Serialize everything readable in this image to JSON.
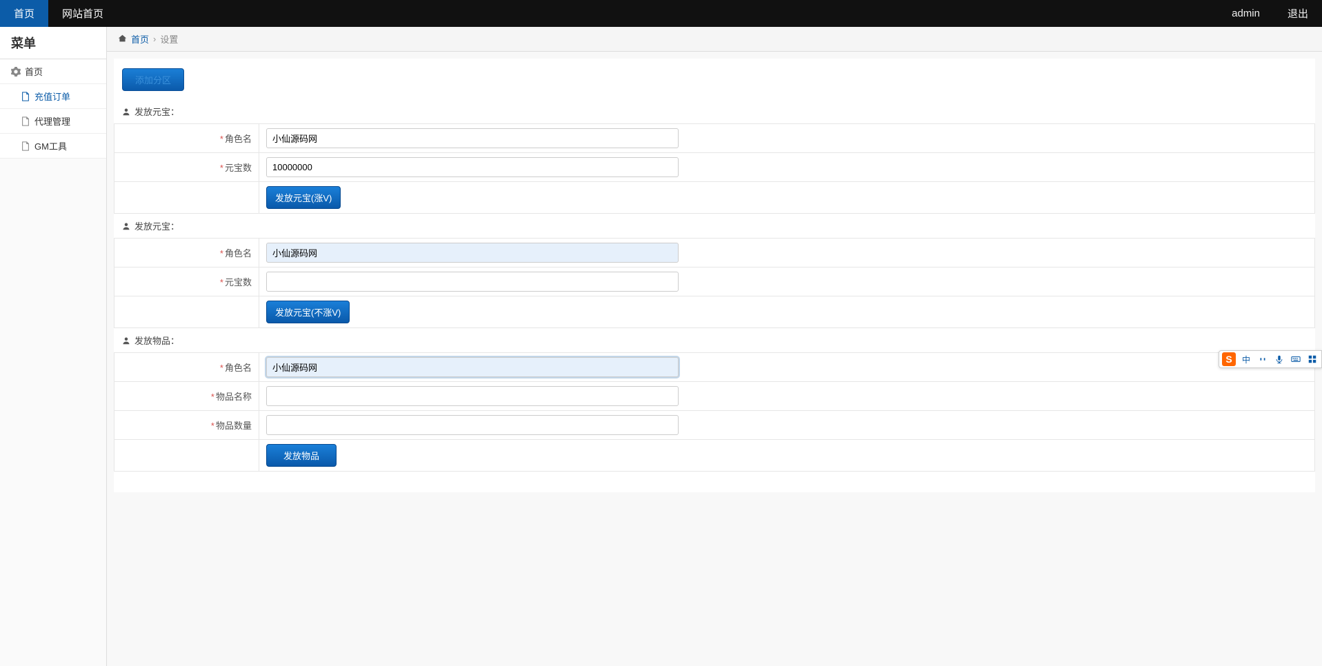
{
  "navbar": {
    "tab_home": "首页",
    "tab_site_home": "网站首页",
    "user": "admin",
    "logout": "退出"
  },
  "sidebar": {
    "title": "菜单",
    "home": "首页",
    "items": [
      {
        "label": "充值订单",
        "active": true
      },
      {
        "label": "代理管理",
        "active": false
      },
      {
        "label": "GM工具",
        "active": false
      }
    ]
  },
  "breadcrumb": {
    "home": "首页",
    "current": "设置"
  },
  "zone_button": "添加分区",
  "sections": [
    {
      "title": "发放元宝：",
      "fields": [
        {
          "label": "角色名",
          "value": "小仙源码网",
          "autofill": false,
          "focus": false
        },
        {
          "label": "元宝数",
          "value": "10000000",
          "autofill": false,
          "focus": false
        }
      ],
      "submit": "发放元宝(涨V)"
    },
    {
      "title": "发放元宝：",
      "fields": [
        {
          "label": "角色名",
          "value": "小仙源码网",
          "autofill": true,
          "focus": false
        },
        {
          "label": "元宝数",
          "value": "",
          "autofill": false,
          "focus": false
        }
      ],
      "submit": "发放元宝(不涨V)"
    },
    {
      "title": "发放物品：",
      "fields": [
        {
          "label": "角色名",
          "value": "小仙源码网",
          "autofill": true,
          "focus": true
        },
        {
          "label": "物品名称",
          "value": "",
          "autofill": false,
          "focus": false
        },
        {
          "label": "物品数量",
          "value": "",
          "autofill": false,
          "focus": false
        }
      ],
      "submit": "发放物品"
    }
  ],
  "ime": {
    "logo": "S",
    "lang": "中"
  }
}
